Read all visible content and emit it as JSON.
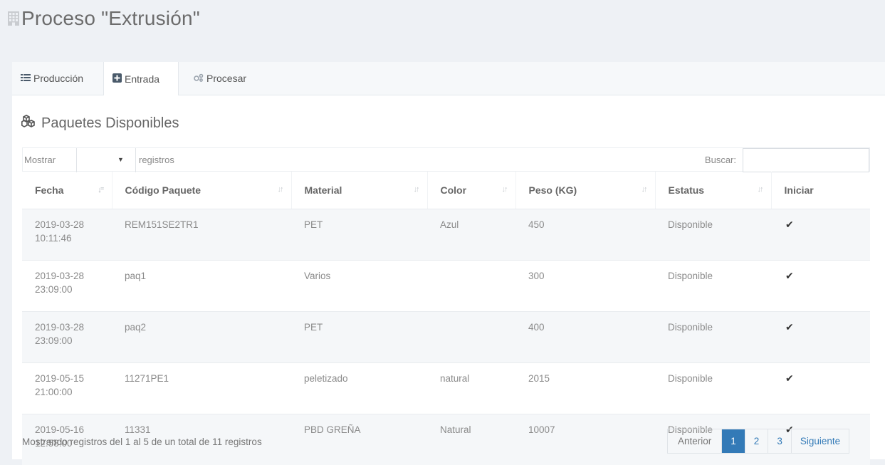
{
  "page": {
    "title": "Proceso \"Extrusión\"",
    "title_icon": "building-icon"
  },
  "tabs": [
    {
      "label": "Producción",
      "icon": "list-icon",
      "active": false
    },
    {
      "label": "Entrada",
      "icon": "plus-square-icon",
      "active": true
    },
    {
      "label": "Procesar",
      "icon": "cogs-icon",
      "active": false
    }
  ],
  "section": {
    "title": "Paquetes Disponibles",
    "icon": "cubes-icon"
  },
  "table_controls": {
    "show_label": "Mostrar",
    "show_value": "",
    "records_label": "registros",
    "search_label": "Buscar:",
    "search_value": ""
  },
  "table": {
    "columns": [
      "Fecha",
      "Código Paquete",
      "Material",
      "Color",
      "Peso (KG)",
      "Estatus",
      "Iniciar"
    ],
    "rows": [
      {
        "fecha_date": "2019-03-28",
        "fecha_time": "10:11:46",
        "codigo": "REM151SE2TR1",
        "material": "PET",
        "color": "Azul",
        "peso": "450",
        "estatus": "Disponible",
        "iniciar": "✔"
      },
      {
        "fecha_date": "2019-03-28",
        "fecha_time": "23:09:00",
        "codigo": "paq1",
        "material": "Varios",
        "color": "",
        "peso": "300",
        "estatus": "Disponible",
        "iniciar": "✔"
      },
      {
        "fecha_date": "2019-03-28",
        "fecha_time": "23:09:00",
        "codigo": "paq2",
        "material": "PET",
        "color": "",
        "peso": "400",
        "estatus": "Disponible",
        "iniciar": "✔"
      },
      {
        "fecha_date": "2019-05-15",
        "fecha_time": "21:00:00",
        "codigo": "11271PE1",
        "material": "peletizado",
        "color": "natural",
        "peso": "2015",
        "estatus": "Disponible",
        "iniciar": "✔"
      },
      {
        "fecha_date": "2019-05-16",
        "fecha_time": "12:58:00",
        "codigo": "11331",
        "material": "PBD GREÑA",
        "color": "Natural",
        "peso": "10007",
        "estatus": "Disponible",
        "iniciar": "✔"
      }
    ]
  },
  "footer": {
    "info": "Mostrando registros del 1 al 5 de un total de 11 registros"
  },
  "pagination": {
    "prev": "Anterior",
    "pages": [
      "1",
      "2",
      "3"
    ],
    "current": "1",
    "next": "Siguiente"
  },
  "colors": {
    "accent": "#337ab7",
    "background": "#eef1f5",
    "stripe": "#f5f7f9"
  }
}
